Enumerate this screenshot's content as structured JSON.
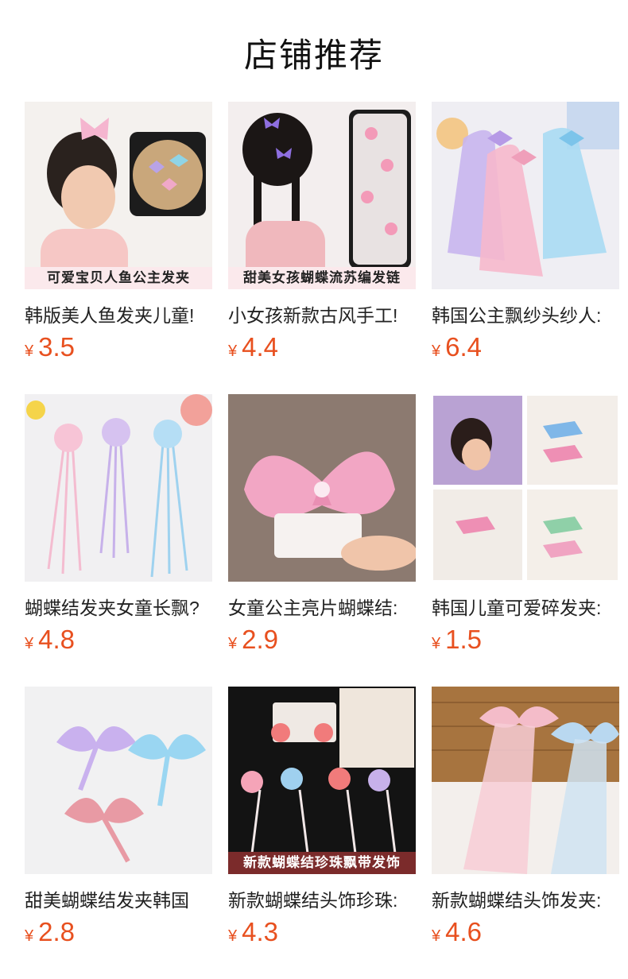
{
  "page": {
    "title": "店铺推荐"
  },
  "currency_symbol": "¥",
  "products": [
    {
      "name": "韩版美人鱼发夹儿童!",
      "price": "3.5",
      "image_caption": "可爱宝贝人鱼公主发夹",
      "image_icon": "mermaid-hairclip-photo"
    },
    {
      "name": "小女孩新款古风手工!",
      "price": "4.4",
      "image_caption": "甜美女孩蝴蝶流苏编发链",
      "image_icon": "butterfly-hair-chain-photo"
    },
    {
      "name": "韩国公主飘纱头纱人:",
      "price": "6.4",
      "image_caption": "",
      "image_icon": "tulle-bow-veil-photo"
    },
    {
      "name": "蝴蝶结发夹女童长飘?",
      "price": "4.8",
      "image_caption": "",
      "image_icon": "ribbon-tassel-clip-photo"
    },
    {
      "name": "女童公主亮片蝴蝶结:",
      "price": "2.9",
      "image_caption": "",
      "image_icon": "sequin-bow-photo"
    },
    {
      "name": "韩国儿童可爱碎发夹:",
      "price": "1.5",
      "image_caption": "",
      "image_icon": "fish-clip-collage-photo"
    },
    {
      "name": "甜美蝴蝶结发夹韩国",
      "price": "2.8",
      "image_caption": "",
      "image_icon": "satin-bow-photo"
    },
    {
      "name": "新款蝴蝶结头饰珍珠:",
      "price": "4.3",
      "image_caption": "新款蝴蝶结珍珠飘带发饰",
      "image_icon": "pearl-ribbon-headwear-photo"
    },
    {
      "name": "新款蝴蝶结头饰发夹:",
      "price": "4.6",
      "image_caption": "",
      "image_icon": "long-ribbon-bow-photo"
    }
  ]
}
